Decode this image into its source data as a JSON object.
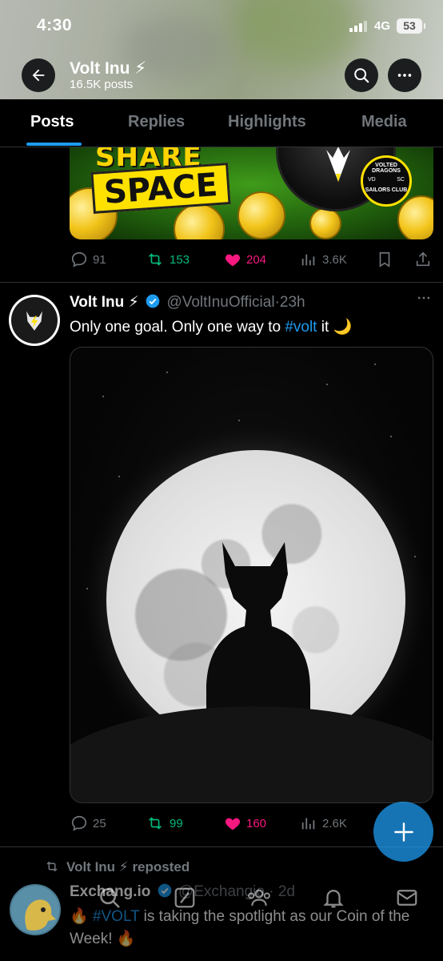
{
  "status_bar": {
    "time": "4:30",
    "network": "4G",
    "battery": "53"
  },
  "header": {
    "title": "Volt Inu ⚡",
    "post_count": "16.5K posts"
  },
  "tabs": [
    {
      "label": "Posts",
      "active": true
    },
    {
      "label": "Replies",
      "active": false
    },
    {
      "label": "Highlights",
      "active": false
    },
    {
      "label": "Media",
      "active": false
    }
  ],
  "banner": {
    "line1": "SHARE",
    "line2": "SPACE",
    "badge_top": "VOLTED DRAGONS",
    "badge_mid_left": "VD",
    "badge_mid_right": "SC",
    "badge_bottom": "SAILORS CLUB"
  },
  "prev_post_actions": {
    "replies": "91",
    "reposts": "153",
    "likes": "204",
    "views": "3.6K"
  },
  "post": {
    "name": "Volt Inu ⚡",
    "handle": "@VoltInuOfficial",
    "time": "23h",
    "text_before": "Only one goal. Only one way to ",
    "hashtag": "#volt",
    "text_after": " it 🌙",
    "actions": {
      "replies": "25",
      "reposts": "99",
      "likes": "160",
      "views": "2.6K"
    }
  },
  "next_post": {
    "repost_label": "Volt Inu ⚡ reposted",
    "name": "Exchang.io",
    "handle": "@Exchangio",
    "time": "2d",
    "text_pre": "🔥 ",
    "hashtag": "#VOLT",
    "text_post": " is taking the spotlight as our Coin of the Week! 🔥"
  },
  "colors": {
    "accent": "#1d9bf0",
    "like": "#f91880",
    "repost": "#00ba7c",
    "muted": "#71767b",
    "background": "#000000"
  },
  "icons": {
    "back": "arrow-left-icon",
    "search": "search-icon",
    "more": "more-horizontal-icon",
    "reply": "reply-icon",
    "repost": "repost-icon",
    "like": "heart-icon",
    "views": "views-icon",
    "bookmark": "bookmark-icon",
    "share": "share-icon",
    "compose": "plus-icon",
    "nav": [
      "home-icon",
      "search-icon",
      "grok-icon",
      "communities-icon",
      "notifications-icon",
      "messages-icon"
    ]
  }
}
